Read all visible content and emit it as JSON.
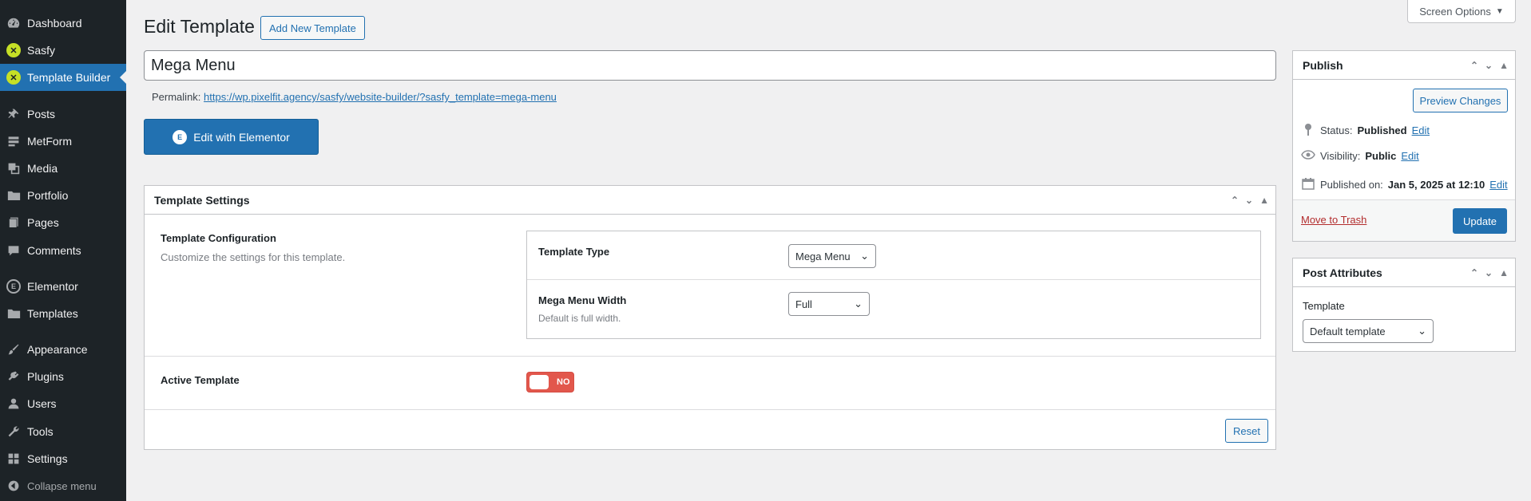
{
  "sidebar": {
    "items": [
      {
        "label": "Dashboard",
        "icon": "dashboard-icon"
      },
      {
        "label": "Sasfy",
        "icon": "sasfy-icon"
      },
      {
        "label": "Template Builder",
        "icon": "sasfy-icon"
      },
      {
        "label": "Posts",
        "icon": "pin-icon"
      },
      {
        "label": "MetForm",
        "icon": "form-icon"
      },
      {
        "label": "Media",
        "icon": "media-icon"
      },
      {
        "label": "Portfolio",
        "icon": "folder-icon"
      },
      {
        "label": "Pages",
        "icon": "pages-icon"
      },
      {
        "label": "Comments",
        "icon": "comment-icon"
      },
      {
        "label": "Elementor",
        "icon": "elementor-icon"
      },
      {
        "label": "Templates",
        "icon": "folder-icon"
      },
      {
        "label": "Appearance",
        "icon": "brush-icon"
      },
      {
        "label": "Plugins",
        "icon": "plugin-icon"
      },
      {
        "label": "Users",
        "icon": "user-icon"
      },
      {
        "label": "Tools",
        "icon": "wrench-icon"
      },
      {
        "label": "Settings",
        "icon": "settings-icon"
      }
    ],
    "active": "Template Builder",
    "collapse_label": "Collapse menu"
  },
  "header": {
    "title": "Edit Template",
    "add_new_label": "Add New Template",
    "screen_options_label": "Screen Options"
  },
  "post": {
    "title": "Mega Menu",
    "permalink_label": "Permalink:",
    "permalink_url": "https://wp.pixelfit.agency/sasfy/website-builder/?sasfy_template=mega-menu",
    "edit_with_elementor_label": "Edit with Elementor"
  },
  "template_settings": {
    "heading": "Template Settings",
    "config_title": "Template Configuration",
    "config_desc": "Customize the settings for this template.",
    "template_type_label": "Template Type",
    "template_type_value": "Mega Menu",
    "width_label": "Mega Menu Width",
    "width_desc": "Default is full width.",
    "width_value": "Full",
    "active_label": "Active Template",
    "active_toggle_text": "NO",
    "reset_label": "Reset"
  },
  "publish": {
    "heading": "Publish",
    "preview_label": "Preview Changes",
    "status_label": "Status:",
    "status_value": "Published",
    "visibility_label": "Visibility:",
    "visibility_value": "Public",
    "published_on_label": "Published on:",
    "published_on_value": "Jan 5, 2025 at 12:10",
    "edit_link": "Edit",
    "trash_label": "Move to Trash",
    "update_label": "Update"
  },
  "post_attributes": {
    "heading": "Post Attributes",
    "template_label": "Template",
    "template_value": "Default template"
  },
  "colors": {
    "sidebar_bg": "#1d2327",
    "accent": "#2271b1",
    "toggle_off": "#e2574c",
    "sasfy_green": "#c6e026"
  }
}
